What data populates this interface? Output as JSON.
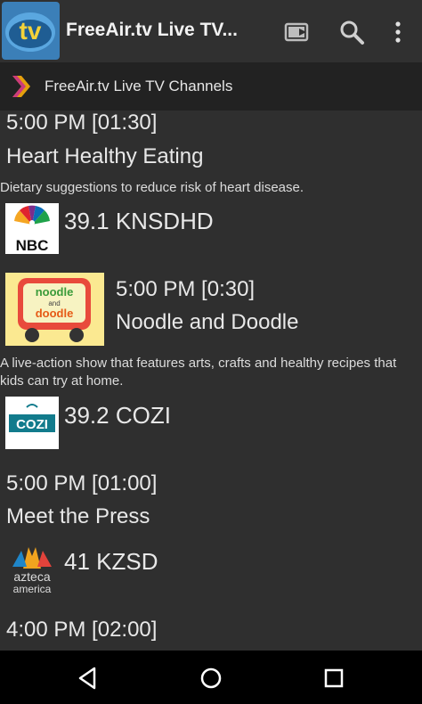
{
  "appbar": {
    "title": "FreeAir.tv Live TV...",
    "logo_text": "tv",
    "icons": [
      "cast-icon",
      "search-icon",
      "overflow-menu-icon"
    ]
  },
  "subbar": {
    "title": "FreeAir.tv Live TV Channels",
    "icon": "plex-chevron-icon"
  },
  "listing": {
    "item1": {
      "time": "5:00 PM [01:30]",
      "show": "Heart Healthy Eating",
      "description": "Dietary suggestions to reduce risk of heart disease."
    },
    "channel1": {
      "name": "39.1 KNSDHD",
      "logo_text": "NBC"
    },
    "item2": {
      "thumb_line1": "noodle",
      "thumb_line2": "and",
      "thumb_line3": "doodle",
      "time": "5:00 PM [0:30]",
      "show": "Noodle and Doodle",
      "description": "A live-action show that features arts, crafts and healthy recipes that kids can try at home."
    },
    "channel2": {
      "name": "39.2 COZI",
      "logo_text": "COZI"
    },
    "item3": {
      "time": "5:00 PM [01:00]",
      "show": "Meet the Press"
    },
    "channel3": {
      "name": "41 KZSD",
      "logo_line1": "azteca",
      "logo_line2": "america"
    },
    "item4": {
      "time": "4:00 PM [02:00]"
    }
  },
  "navbar": {
    "icons": [
      "back-icon",
      "home-icon",
      "recents-icon"
    ]
  },
  "colors": {
    "background": "#2f2f2f",
    "appbar": "#303030",
    "subbar": "#222222",
    "navbar": "#000000",
    "text": "#e8e8e8"
  }
}
